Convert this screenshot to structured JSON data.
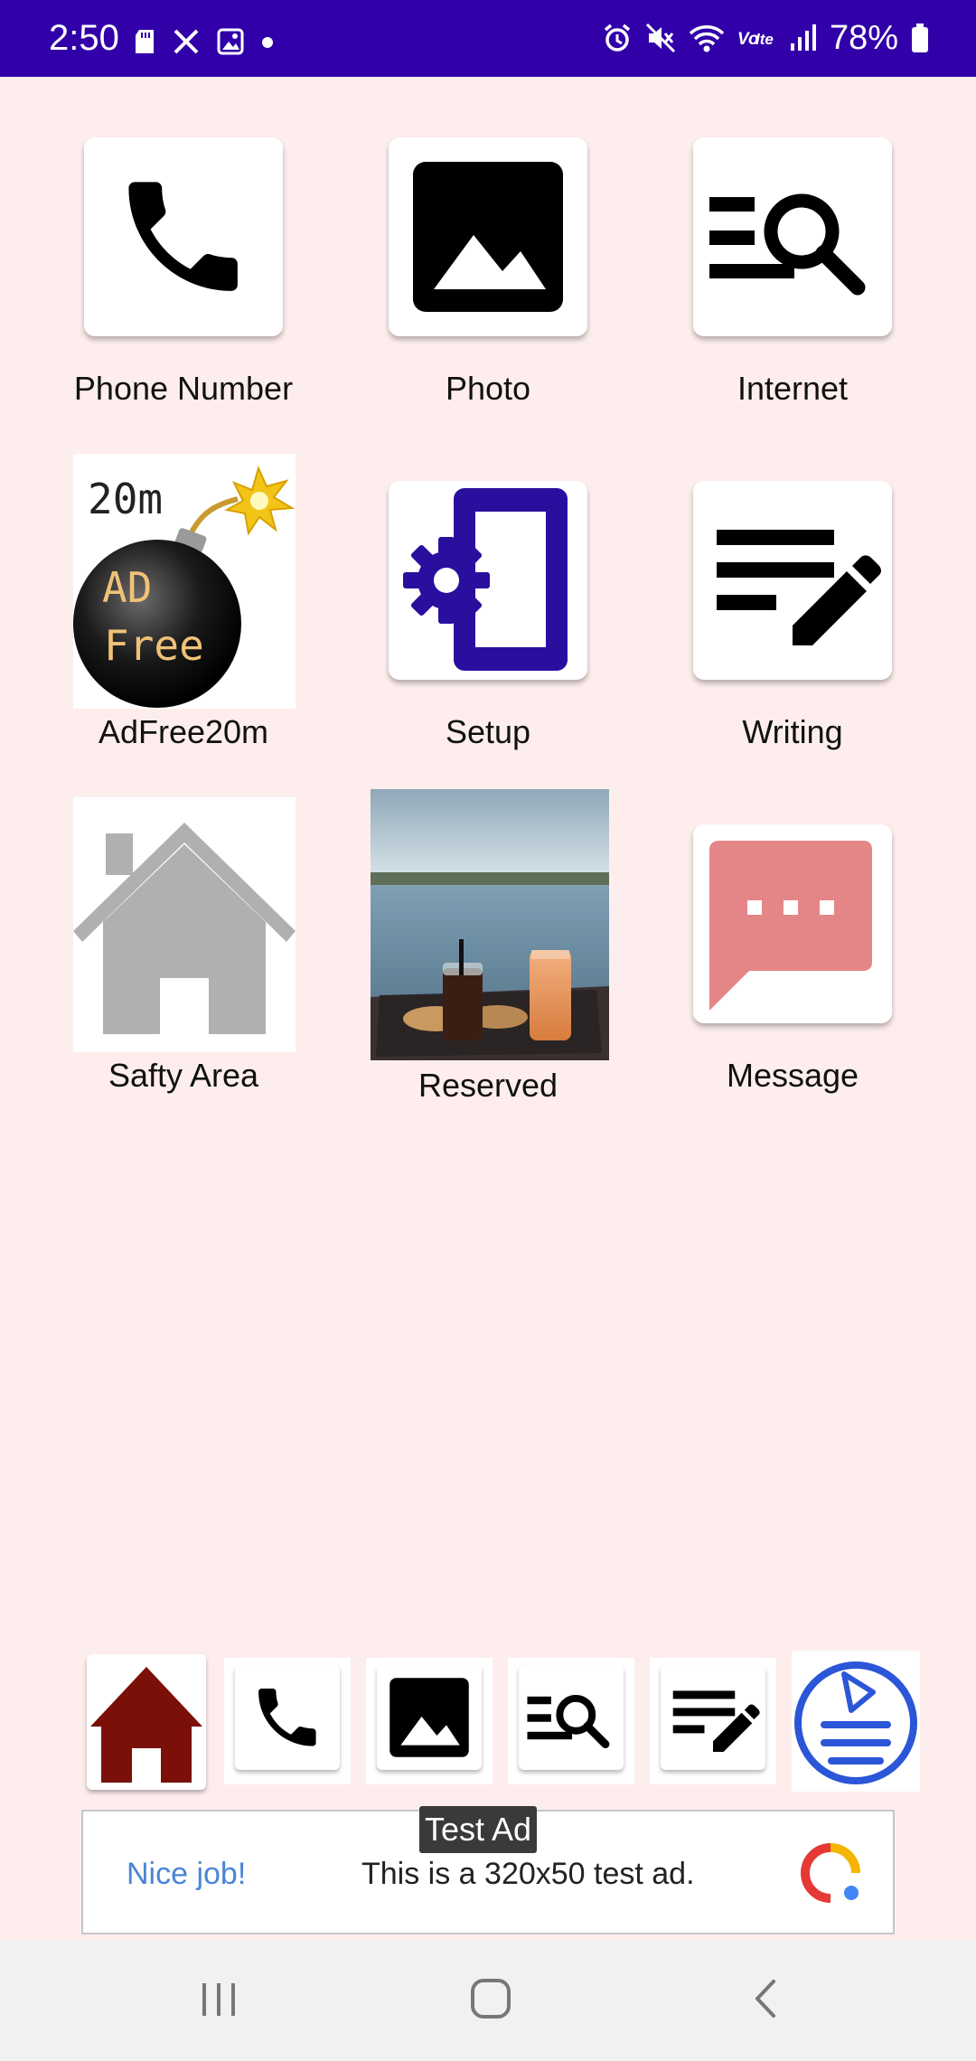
{
  "status_bar": {
    "time": "2:50",
    "battery": "78%",
    "left_icons": [
      "sd-card-icon",
      "tools-icon",
      "image-icon",
      "dot-icon"
    ],
    "right_icons": [
      "alarm-icon",
      "mute-icon",
      "wifi-icon",
      "volte-icon",
      "signal-icon",
      "battery-icon"
    ]
  },
  "apps": [
    {
      "label": "Phone Number",
      "icon": "phone-icon"
    },
    {
      "label": "Photo",
      "icon": "photo-icon"
    },
    {
      "label": "Internet",
      "icon": "search-list-icon"
    },
    {
      "label": "AdFree20m",
      "icon": "bomb-icon",
      "icon_text": [
        "20m",
        "AD",
        "Free"
      ]
    },
    {
      "label": "Setup",
      "icon": "phone-settings-icon"
    },
    {
      "label": "Writing",
      "icon": "writing-icon"
    },
    {
      "label": "Safty Area",
      "icon": "house-icon"
    },
    {
      "label": "Reserved",
      "icon": "drinks-photo"
    },
    {
      "label": "Message",
      "icon": "message-icon"
    }
  ],
  "dock": [
    {
      "icon": "home-icon"
    },
    {
      "icon": "phone-icon"
    },
    {
      "icon": "photo-icon"
    },
    {
      "icon": "search-list-icon"
    },
    {
      "icon": "writing-icon"
    },
    {
      "icon": "menu-play-icon"
    }
  ],
  "ad": {
    "tag": "Test Ad",
    "nice": "Nice job!",
    "text": "This is a 320x50 test ad."
  },
  "nav": [
    "recents-button",
    "home-button",
    "back-button"
  ],
  "colors": {
    "status_bar": "#3200a8",
    "background": "#fdeeed",
    "setup_blue": "#2a0f9e",
    "message_red": "#e48688",
    "house_gray": "#b0b0b0",
    "dock_home": "#7a1008"
  }
}
